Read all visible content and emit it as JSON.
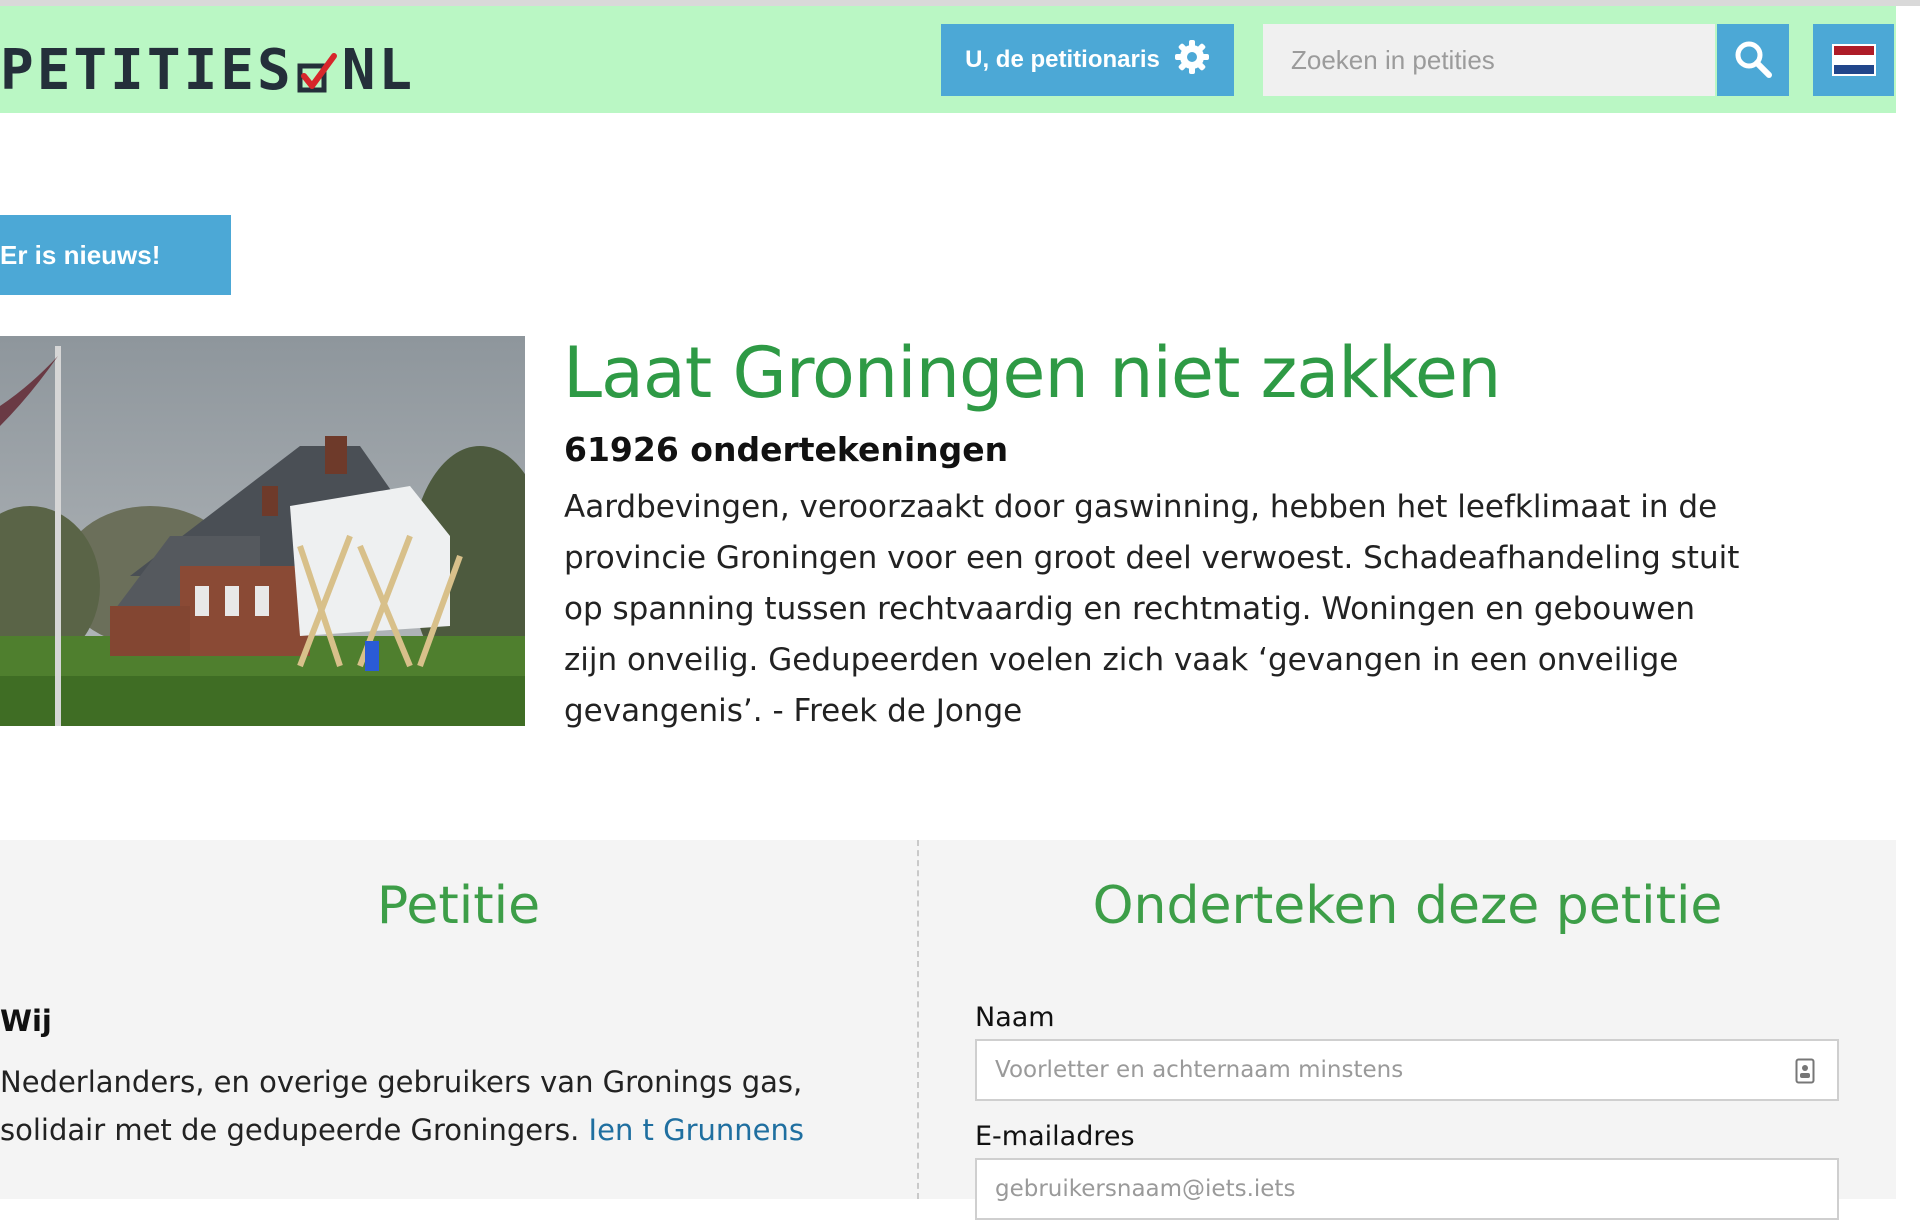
{
  "header": {
    "logo_text": "PETITIES",
    "logo_suffix": "NL",
    "account_button": "U, de petitionaris",
    "search_placeholder": "Zoeken in petities",
    "flag_colors": [
      "#ae1c28",
      "#ffffff",
      "#21468b"
    ]
  },
  "news_button": "Er is nieuws!",
  "petition": {
    "title": "Laat Groningen niet zakken",
    "signatures": "61926 ondertekeningen",
    "description": "Aardbevingen, veroorzaakt door gaswinning, hebben het leefklimaat in de provincie Groningen voor een groot deel verwoest. Schadeafhandeling stuit op spanning tussen rechtvaardig en rechtmatig. Woningen en gebouwen zijn onveilig. Gedupeerden voelen zich vaak ‘gevangen in een onveilige gevangenis’. - Freek de Jonge"
  },
  "left_panel": {
    "title": "Petitie",
    "subhead": "Wij",
    "text": "Nederlanders, en overige gebruikers van Gronings gas, solidair met de gedupeerde Groningers.",
    "link": "Ien t Grunnens"
  },
  "right_panel": {
    "title": "Onderteken deze petitie",
    "name_label": "Naam",
    "name_placeholder": "Voorletter en achternaam minstens",
    "email_label": "E-mailadres",
    "email_placeholder": "gebruikersnaam@iets.iets"
  },
  "colors": {
    "header_bg": "#baf7c4",
    "accent_blue": "#4ca8d6",
    "title_green": "#2e9a45",
    "panel_bg": "#f4f4f4"
  }
}
